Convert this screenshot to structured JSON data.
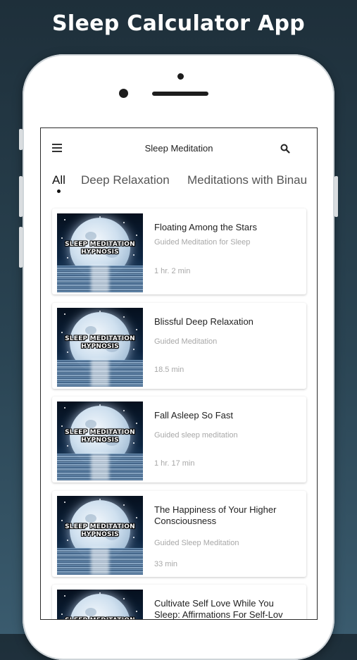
{
  "promo": {
    "title": "Sleep Calculator App"
  },
  "appbar": {
    "title": "Sleep Meditation"
  },
  "tabs": [
    {
      "label": "All"
    },
    {
      "label": "Deep Relaxation"
    },
    {
      "label": "Meditations with Binau"
    }
  ],
  "thumbnail_text": {
    "line1": "SLEEP MEDITATION",
    "line2": "HYPNOSIS"
  },
  "items": [
    {
      "title": "Floating Among the Stars",
      "subtitle": "Guided Meditation for Sleep",
      "duration": "1 hr. 2 min"
    },
    {
      "title": "Blissful Deep Relaxation",
      "subtitle": "Guided Meditation",
      "duration": "18.5 min"
    },
    {
      "title": "Fall Asleep So Fast",
      "subtitle": "Guided sleep meditation",
      "duration": "1 hr. 17 min"
    },
    {
      "title": "The Happiness of Your Higher Consciousness",
      "subtitle": "Guided Sleep Meditation",
      "duration": "33 min"
    },
    {
      "title": "Cultivate Self Love While You Sleep: Affirmations For Self-Lov",
      "subtitle": "",
      "duration": ""
    }
  ],
  "colors": {
    "background": "#2a4453",
    "accent": "#111111",
    "muted_text": "#a8a8a8"
  },
  "icons": {
    "menu": "hamburger-menu-icon",
    "search": "search-icon"
  }
}
